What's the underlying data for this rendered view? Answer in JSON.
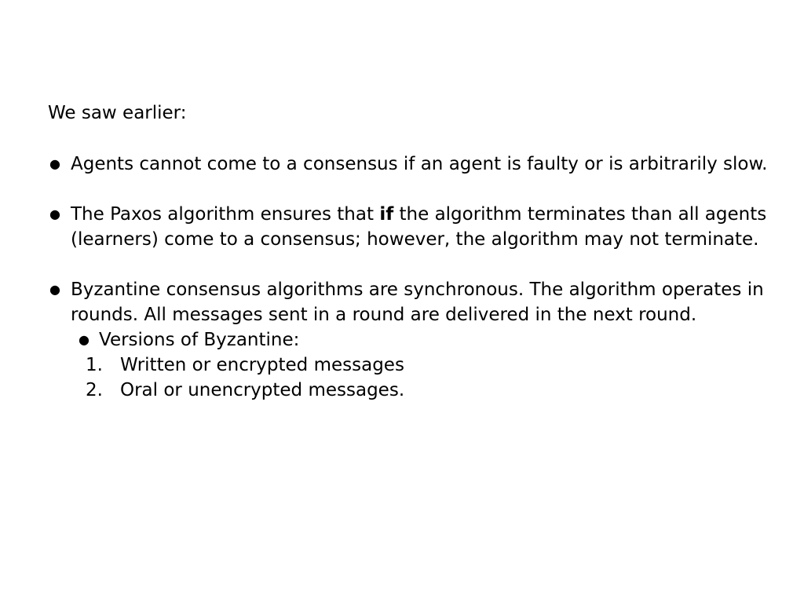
{
  "slide": {
    "intro": "We saw earlier:",
    "bullet_glyph": "●",
    "bullets": [
      {
        "text": "Agents cannot come to a consensus if an agent is faulty or is arbitrarily slow."
      },
      {
        "text_before": "The Paxos algorithm ensures that ",
        "text_bold": "if",
        "text_after": " the algorithm terminates than all agents (learners) come to a consensus; however, the algorithm may not terminate."
      },
      {
        "text": "Byzantine consensus algorithms are synchronous. The algorithm operates in rounds. All messages sent in a round are delivered in the next round.",
        "sub_bullet": "Versions of Byzantine:",
        "numbered": [
          {
            "num": "1.",
            "text": "Written or encrypted messages"
          },
          {
            "num": "2.",
            "text": "Oral or unencrypted messages."
          }
        ]
      }
    ]
  }
}
